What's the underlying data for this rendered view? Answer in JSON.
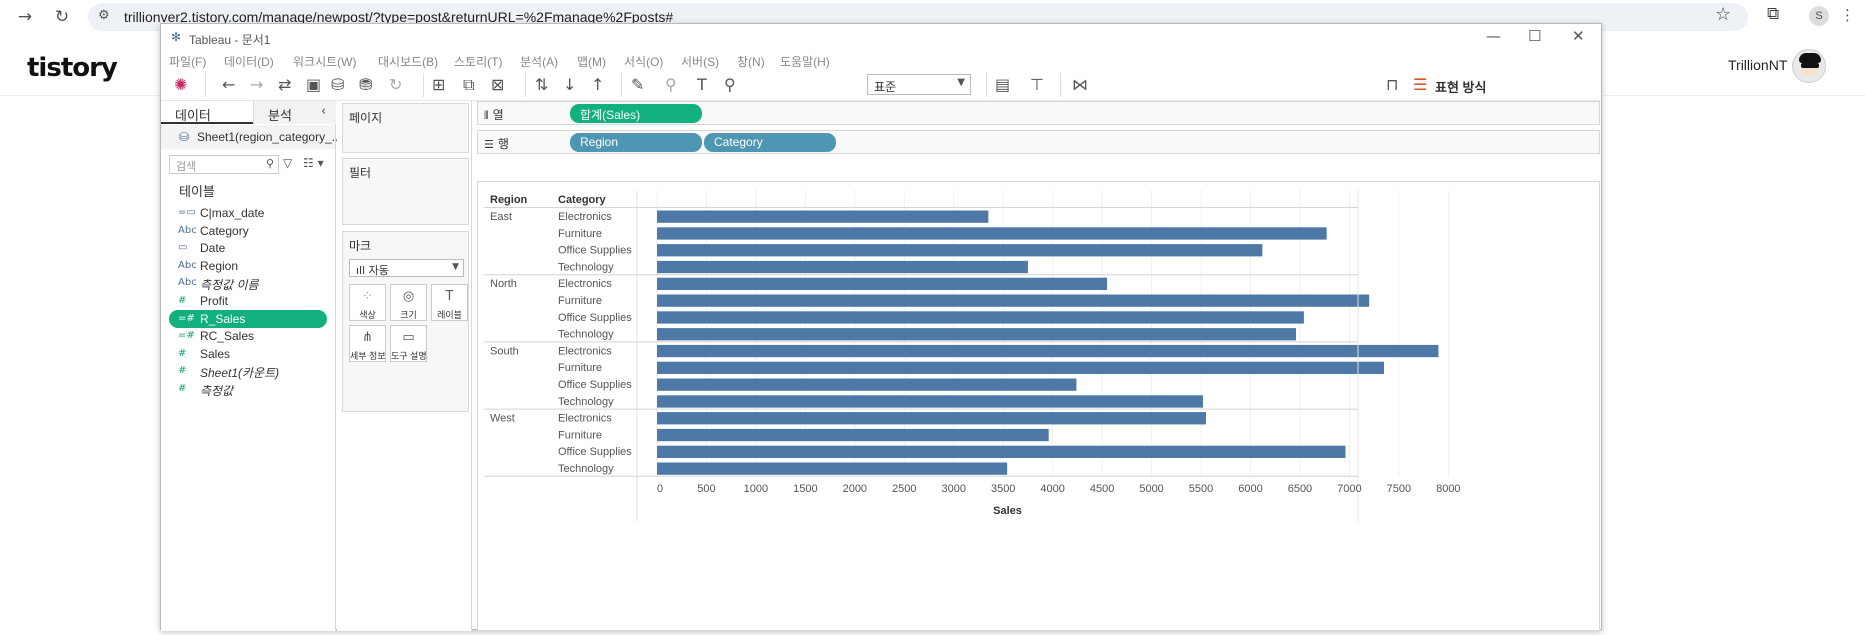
{
  "browser": {
    "url": "trillionver2.tistory.com/manage/newpost/?type=post&returnURL=%2Fmanage%2Fposts#",
    "profile_initial": "S"
  },
  "tistory": {
    "logo": "tistory",
    "username": "TrillionNT"
  },
  "tableau": {
    "window_title": "Tableau - 문서1",
    "menu": [
      "파일(F)",
      "데이터(D)",
      "워크시트(W)",
      "대시보드(B)",
      "스토리(T)",
      "분석(A)",
      "맵(M)",
      "서식(O)",
      "서버(S)",
      "창(N)",
      "도움말(H)"
    ],
    "toolbar": {
      "fit_select": "표준",
      "show_me": "표현 방식"
    },
    "data_pane": {
      "tab_data": "데이터",
      "tab_analysis": "분석",
      "source": "Sheet1(region_category_...",
      "search_placeholder": "검색",
      "section_tables": "테이블",
      "fields": [
        {
          "name": "C|max_date",
          "icon": "calc-date-icon",
          "type": "date-calc",
          "italic": false
        },
        {
          "name": "Category",
          "icon": "abc-icon",
          "type": "string",
          "italic": false
        },
        {
          "name": "Date",
          "icon": "date-icon",
          "type": "date",
          "italic": false
        },
        {
          "name": "Region",
          "icon": "abc-icon",
          "type": "string",
          "italic": false
        },
        {
          "name": "측정값 이름",
          "icon": "abc-icon",
          "type": "string",
          "italic": true
        },
        {
          "name": "Profit",
          "icon": "number-icon",
          "type": "number",
          "italic": false
        },
        {
          "name": "R_Sales",
          "icon": "calc-number-icon",
          "type": "number-calc",
          "italic": false,
          "selected": true
        },
        {
          "name": "RC_Sales",
          "icon": "calc-number-icon",
          "type": "number-calc",
          "italic": false
        },
        {
          "name": "Sales",
          "icon": "number-icon",
          "type": "number",
          "italic": false
        },
        {
          "name": "Sheet1(카운트)",
          "icon": "number-icon",
          "type": "number",
          "italic": true
        },
        {
          "name": "측정값",
          "icon": "number-icon",
          "type": "number",
          "italic": true
        }
      ]
    },
    "cards": {
      "pages": "페이지",
      "filters": "필터",
      "marks": "마크",
      "marks_type": "자동",
      "mark_buttons": [
        {
          "label": "색상",
          "icon": "color-icon"
        },
        {
          "label": "크기",
          "icon": "size-icon"
        },
        {
          "label": "레이블",
          "icon": "label-icon"
        },
        {
          "label": "세부 정보",
          "icon": "detail-icon"
        },
        {
          "label": "도구 설명",
          "icon": "tooltip-icon"
        }
      ]
    },
    "shelves": {
      "columns_label": "열",
      "rows_label": "행",
      "columns_pills": [
        "합계(Sales)"
      ],
      "rows_pills": [
        "Region",
        "Category"
      ]
    }
  },
  "chart_data": {
    "type": "bar",
    "orientation": "horizontal",
    "row_headers": [
      "Region",
      "Category"
    ],
    "xlabel": "Sales",
    "xlim": [
      0,
      8300
    ],
    "xticks": [
      0,
      500,
      1000,
      1500,
      2000,
      2500,
      3000,
      3500,
      4000,
      4500,
      5000,
      5500,
      6000,
      6500,
      7000,
      7500,
      8000
    ],
    "bar_color": "#4e79a7",
    "groups": [
      {
        "region": "East",
        "rows": [
          {
            "category": "Electronics",
            "value": 3350
          },
          {
            "category": "Furniture",
            "value": 6770
          },
          {
            "category": "Office Supplies",
            "value": 6120
          },
          {
            "category": "Technology",
            "value": 3750
          }
        ]
      },
      {
        "region": "North",
        "rows": [
          {
            "category": "Electronics",
            "value": 4550
          },
          {
            "category": "Furniture",
            "value": 7200
          },
          {
            "category": "Office Supplies",
            "value": 6540
          },
          {
            "category": "Technology",
            "value": 6460
          }
        ]
      },
      {
        "region": "South",
        "rows": [
          {
            "category": "Electronics",
            "value": 7900
          },
          {
            "category": "Furniture",
            "value": 7350
          },
          {
            "category": "Office Supplies",
            "value": 4240
          },
          {
            "category": "Technology",
            "value": 5520
          }
        ]
      },
      {
        "region": "West",
        "rows": [
          {
            "category": "Electronics",
            "value": 5550
          },
          {
            "category": "Furniture",
            "value": 3960
          },
          {
            "category": "Office Supplies",
            "value": 6960
          },
          {
            "category": "Technology",
            "value": 3540
          }
        ]
      }
    ]
  }
}
